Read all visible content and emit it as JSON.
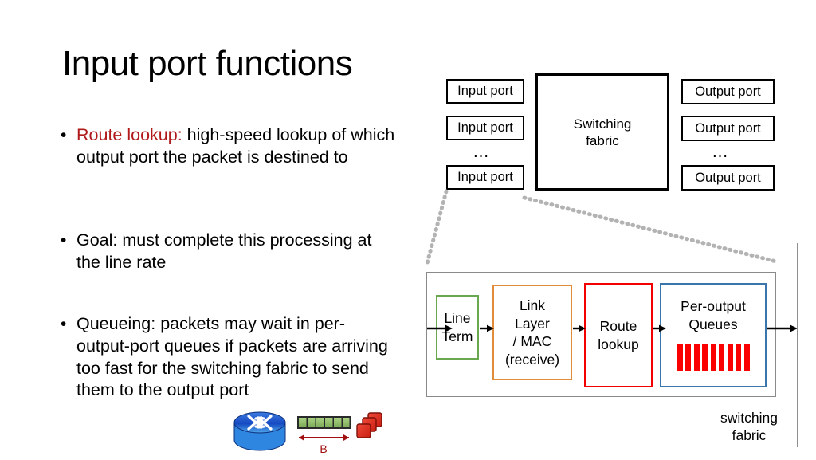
{
  "slide": {
    "title": "Input port functions"
  },
  "bullets": [
    {
      "marker": "•",
      "lead": "Route lookup:",
      "lead_color": "#b01a1a",
      "text": " high-speed lookup of which output port the packet is destined to"
    },
    {
      "marker": "•",
      "lead": "",
      "text": "Goal: must complete this processing at the line rate"
    },
    {
      "marker": "•",
      "lead": "",
      "text": "Queueing: packets may wait in per-output-port queues if packets are arriving too fast for the switching fabric to send them to the output port"
    }
  ],
  "router_diagram": {
    "input_ports": [
      "Input port",
      "Input port",
      "Input port"
    ],
    "output_ports": [
      "Output port",
      "Output port",
      "Output port"
    ],
    "input_ellipsis": "…",
    "output_ellipsis": "…",
    "fabric_label": "Switching\nfabric"
  },
  "detail_panel": {
    "stages": [
      {
        "label": "Line\nTerm",
        "border_color": "#6aa84f"
      },
      {
        "label": "Link\nLayer\n/ MAC\n(receive)",
        "border_color": "#e08c39"
      },
      {
        "label": "Route\nlookup",
        "border_color": "#f20000"
      },
      {
        "label": "Per-output\nQueues",
        "border_color": "#3a76ab"
      }
    ],
    "queue_bar_count": 9,
    "queue_bar_color": "#fb0000",
    "fabric_caption": "switching\nfabric"
  },
  "clipart": {
    "router_label": "router-icon",
    "buffer_label": "B",
    "buffer_cell_count": 6,
    "packet_count": 3,
    "buffer_color": "#8cb96a",
    "packet_color": "#e02b20",
    "router_color": "#1f5fd0",
    "arrow_color": "#a01010"
  }
}
